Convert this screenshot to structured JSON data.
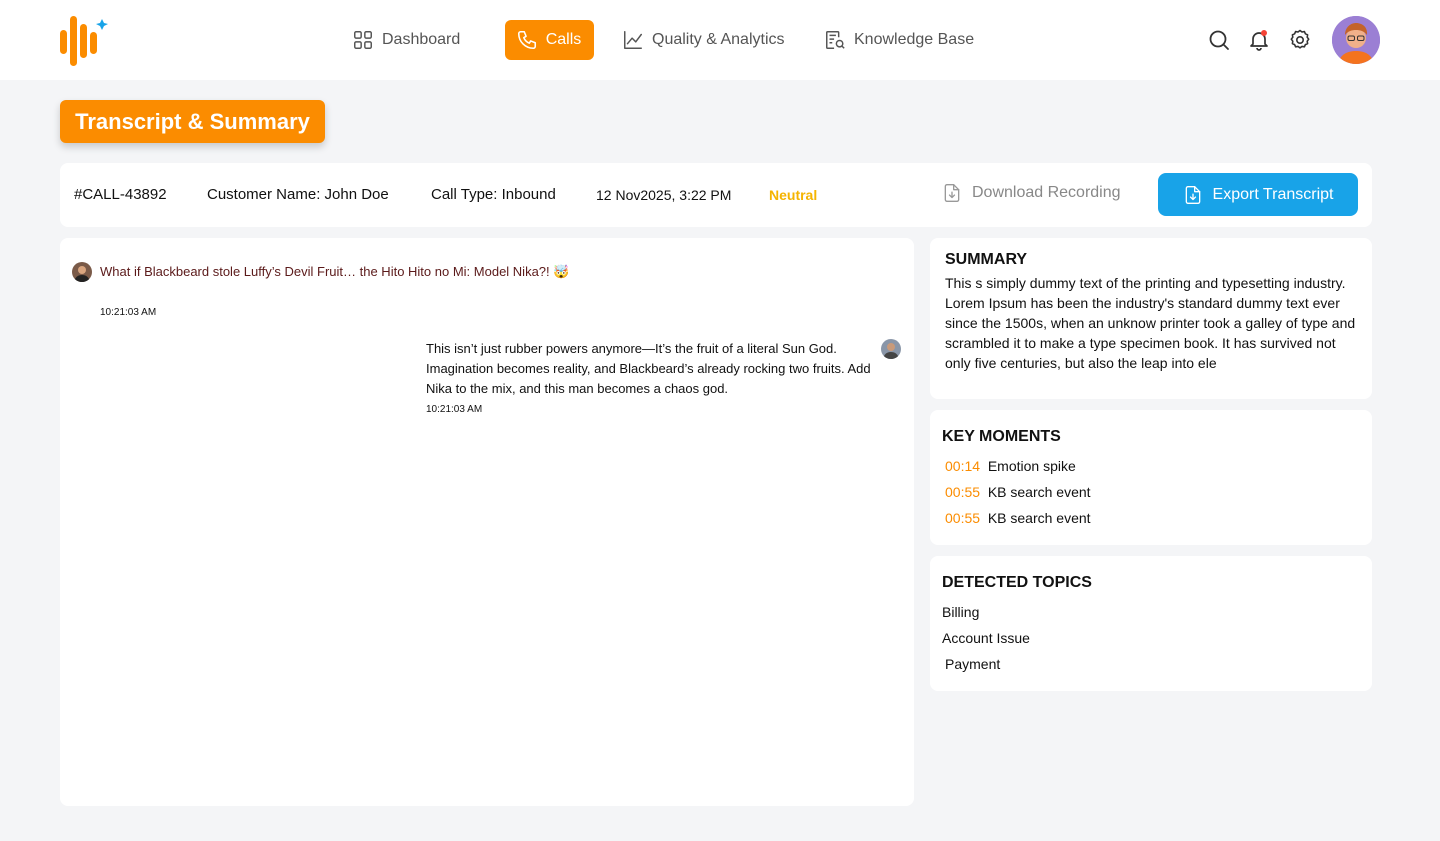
{
  "header": {
    "nav": {
      "dashboard": "Dashboard",
      "calls": "Calls",
      "quality": "Quality & Analytics",
      "knowledge": "Knowledge Base"
    }
  },
  "page": {
    "title": "Transcript & Summary"
  },
  "call": {
    "id": "#CALL-43892",
    "customer": "Customer Name: John Doe",
    "type": "Call Type: Inbound",
    "datetime": "12 Nov2025, 3:22 PM",
    "sentiment": "Neutral",
    "download_label": "Download Recording",
    "export_label": "Export Transcript"
  },
  "transcript": [
    {
      "text": "What if Blackbeard stole Luffy’s Devil Fruit… the Hito Hito no Mi: Model Nika?! 🤯",
      "time": "10:21:03 AM"
    },
    {
      "text": "This isn’t just rubber powers anymore—It’s the fruit of a literal Sun God. Imagination becomes reality, and Blackbeard’s already rocking two fruits. Add Nika to the mix, and this man becomes a chaos god.",
      "time": "10:21:03 AM"
    }
  ],
  "summary": {
    "title": "SUMMARY",
    "text": "This s simply dummy text of the printing and typesetting industry. Lorem Ipsum has been the industry's standard dummy text ever since the 1500s, when an unknow  printer took a galley of type and scrambled it to make a type specimen book. It has survived not only five centuries, but also the leap into ele"
  },
  "key_moments": {
    "title": "KEY MOMENTS",
    "items": [
      {
        "time": "00:14",
        "label": "Emotion spike"
      },
      {
        "time": "00:55",
        "label": "KB search event"
      },
      {
        "time": "00:55",
        "label": "KB search event"
      }
    ]
  },
  "topics": {
    "title": "DETECTED TOPICS",
    "items": [
      "Billing",
      "Account Issue",
      "Payment"
    ]
  },
  "colors": {
    "accent": "#fb8c00",
    "export": "#18a3e8",
    "neutral": "#f5b400"
  }
}
